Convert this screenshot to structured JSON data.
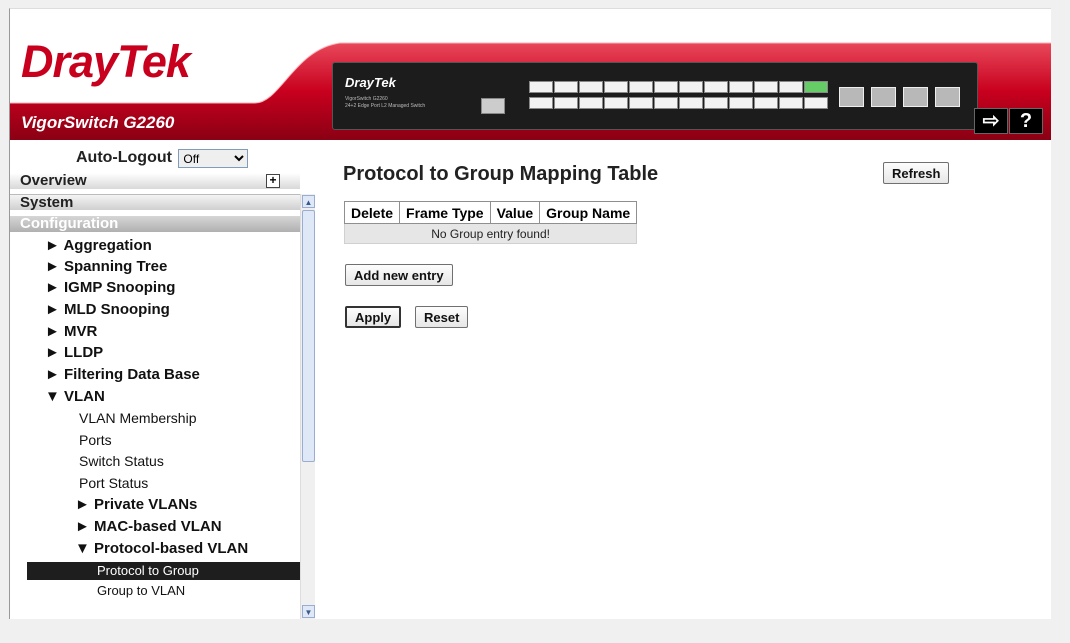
{
  "header": {
    "logo_text": "DrayTek",
    "product_name": "VigorSwitch G2260",
    "device_logo": "DrayTek",
    "device_model": "VigorSwitch G2260",
    "device_desc": "24+2 Edge Port L2 Managed Switch",
    "logout_icon": "logout-icon",
    "help_icon": "help-icon",
    "brand_color": "#c8001e"
  },
  "sidebar": {
    "autologout_label": "Auto-Logout",
    "autologout_value": "Off",
    "overview": "Overview",
    "system": "System",
    "configuration": "Configuration",
    "items": [
      {
        "label": "► Aggregation"
      },
      {
        "label": "► Spanning Tree"
      },
      {
        "label": "► IGMP Snooping"
      },
      {
        "label": "► MLD Snooping"
      },
      {
        "label": "► MVR"
      },
      {
        "label": "► LLDP"
      },
      {
        "label": "► Filtering Data Base"
      },
      {
        "label": "▼ VLAN"
      },
      {
        "label": "VLAN Membership"
      },
      {
        "label": "Ports"
      },
      {
        "label": "Switch Status"
      },
      {
        "label": "Port Status"
      },
      {
        "label": "► Private VLANs"
      },
      {
        "label": "► MAC-based VLAN"
      },
      {
        "label": "▼ Protocol-based VLAN"
      },
      {
        "label": "Protocol to Group"
      },
      {
        "label": "Group to VLAN"
      }
    ]
  },
  "main": {
    "title": "Protocol to Group Mapping Table",
    "refresh_label": "Refresh",
    "table": {
      "headers": [
        "Delete",
        "Frame Type",
        "Value",
        "Group Name"
      ],
      "empty_message": "No Group entry found!"
    },
    "add_entry_label": "Add new entry",
    "apply_label": "Apply",
    "reset_label": "Reset"
  }
}
